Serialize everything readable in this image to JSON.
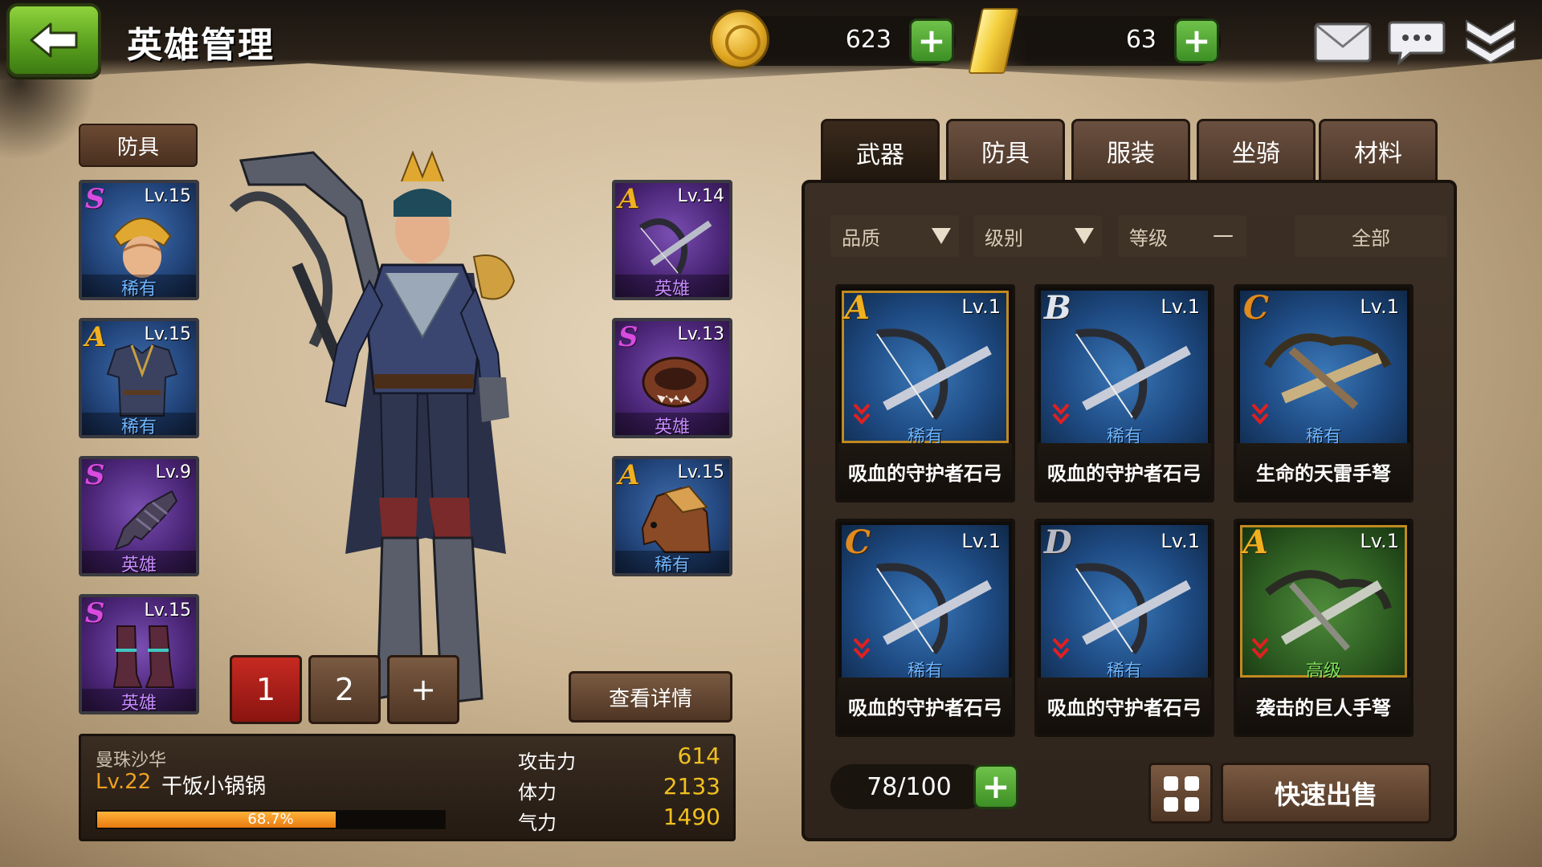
{
  "header": {
    "title": "英雄管理",
    "gold": "623",
    "ingots": "63",
    "icons": [
      "back-arrow-icon",
      "coin-icon",
      "gold-ingot-icon",
      "mail-icon",
      "chat-icon",
      "collapse-menu-icon"
    ]
  },
  "equipment": {
    "header_label": "防具",
    "left_slots": [
      {
        "grade": "S",
        "level": "Lv.15",
        "rarity": "稀有",
        "icon": "helmet-icon"
      },
      {
        "grade": "A",
        "level": "Lv.15",
        "rarity": "稀有",
        "icon": "armor-icon"
      },
      {
        "grade": "S",
        "level": "Lv.9",
        "rarity": "英雄",
        "icon": "gauntlet-icon"
      },
      {
        "grade": "S",
        "level": "Lv.15",
        "rarity": "英雄",
        "icon": "boots-icon"
      }
    ],
    "right_slots": [
      {
        "grade": "A",
        "level": "Lv.14",
        "rarity": "英雄",
        "icon": "crossbow-icon"
      },
      {
        "grade": "S",
        "level": "Lv.13",
        "rarity": "英雄",
        "icon": "ring-icon"
      },
      {
        "grade": "A",
        "level": "Lv.15",
        "rarity": "稀有",
        "icon": "horse-icon"
      }
    ]
  },
  "loadouts": {
    "tab1": "1",
    "tab2": "2",
    "add": "+",
    "details_button": "查看详情"
  },
  "hero": {
    "class": "曼珠沙华",
    "level": "Lv.22",
    "name": "干饭小锅锅",
    "exp_percent": 68.7,
    "exp_label": "68.7%",
    "stats": [
      {
        "label": "攻击力",
        "value": "614"
      },
      {
        "label": "体力",
        "value": "2133"
      },
      {
        "label": "气力",
        "value": "1490"
      }
    ]
  },
  "inventory": {
    "tabs": [
      "武器",
      "防具",
      "服装",
      "坐骑",
      "材料"
    ],
    "active_tab": "武器",
    "filters": {
      "quality": "品质",
      "level": "级别",
      "grade": "等级",
      "grade_value": "—",
      "all": "全部"
    },
    "items": [
      {
        "grade": "A",
        "level": "Lv.1",
        "rarity": "稀有",
        "name": "吸血的守护者石弓",
        "bg": "blue"
      },
      {
        "grade": "B",
        "level": "Lv.1",
        "rarity": "稀有",
        "name": "吸血的守护者石弓",
        "bg": "blue"
      },
      {
        "grade": "C",
        "level": "Lv.1",
        "rarity": "稀有",
        "name": "生命的天雷手弩",
        "bg": "blue"
      },
      {
        "grade": "C",
        "level": "Lv.1",
        "rarity": "稀有",
        "name": "吸血的守护者石弓",
        "bg": "blue"
      },
      {
        "grade": "D",
        "level": "Lv.1",
        "rarity": "稀有",
        "name": "吸血的守护者石弓",
        "bg": "blue"
      },
      {
        "grade": "A",
        "level": "Lv.1",
        "rarity": "高级",
        "name": "袭击的巨人手弩",
        "bg": "green"
      }
    ],
    "capacity": "78/100",
    "quick_sell": "快速出售"
  },
  "colors": {
    "accent_green": "#5aa11f",
    "rarity_blue": "#6fb6ff",
    "rarity_purple": "#c78bff",
    "rarity_green": "#7fe05a",
    "stat_gold": "#f0c020",
    "exp_orange": "#e87a10",
    "active_loadout_red": "#c62a22"
  }
}
